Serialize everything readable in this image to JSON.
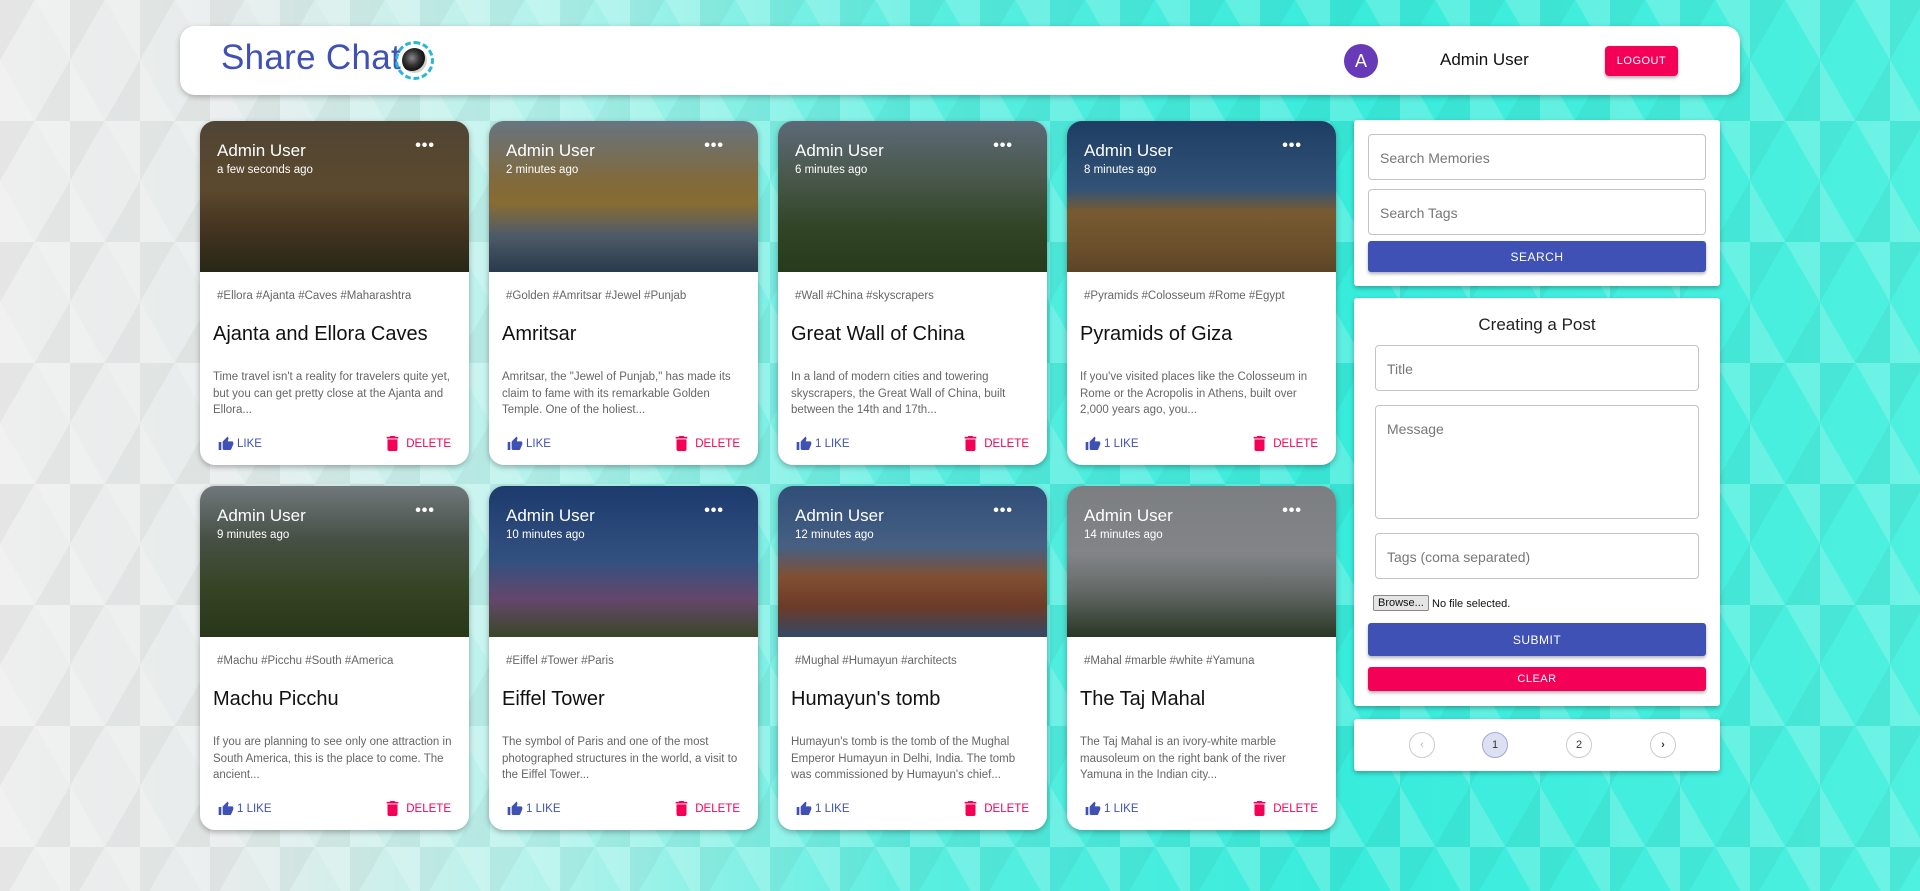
{
  "header": {
    "brand": "Share Chat",
    "avatar_letter": "A",
    "username": "Admin User",
    "logout_label": "LOGOUT"
  },
  "colors": {
    "primary": "#3f51b5",
    "secondary": "#f50057",
    "avatar": "#673ab7"
  },
  "cards": [
    {
      "author": "Admin User",
      "time": "a few seconds ago",
      "tags": "#Ellora #Ajanta #Caves #Maharashtra",
      "title": "Ajanta and Ellora Caves",
      "message": "Time travel isn't a reality for travelers quite yet, but you can get pretty close at the Ajanta and Ellora...",
      "like": "LIKE",
      "delete": "DELETE"
    },
    {
      "author": "Admin User",
      "time": "2 minutes ago",
      "tags": "#Golden #Amritsar #Jewel #Punjab",
      "title": "Amritsar",
      "message": "Amritsar, the \"Jewel of Punjab,\" has made its claim to fame with its remarkable Golden Temple. One of the holiest...",
      "like": "LIKE",
      "delete": "DELETE"
    },
    {
      "author": "Admin User",
      "time": "6 minutes ago",
      "tags": "#Wall #China #skyscrapers",
      "title": "Great Wall of China",
      "message": "In a land of modern cities and towering skyscrapers, the Great Wall of China, built between the 14th and 17th...",
      "like": "1 LIKE",
      "delete": "DELETE"
    },
    {
      "author": "Admin User",
      "time": "8 minutes ago",
      "tags": "#Pyramids #Colosseum #Rome #Egypt",
      "title": "Pyramids of Giza",
      "message": "If you've visited places like the Colosseum in Rome or the Acropolis in Athens, built over 2,000 years ago, you...",
      "like": "1 LIKE",
      "delete": "DELETE"
    },
    {
      "author": "Admin User",
      "time": "9 minutes ago",
      "tags": "#Machu #Picchu #South #America",
      "title": "Machu Picchu",
      "message": "If you are planning to see only one attraction in South America, this is the place to come. The ancient...",
      "like": "1 LIKE",
      "delete": "DELETE"
    },
    {
      "author": "Admin User",
      "time": "10 minutes ago",
      "tags": "#Eiffel #Tower #Paris",
      "title": "Eiffel Tower",
      "message": "The symbol of Paris and one of the most photographed structures in the world, a visit to the Eiffel Tower...",
      "like": "1 LIKE",
      "delete": "DELETE"
    },
    {
      "author": "Admin User",
      "time": "12 minutes ago",
      "tags": "#Mughal #Humayun #architects",
      "title": "Humayun's tomb",
      "message": "Humayun's tomb is the tomb of the Mughal Emperor Humayun in Delhi, India. The tomb was commissioned by Humayun's chief...",
      "like": "1 LIKE",
      "delete": "DELETE"
    },
    {
      "author": "Admin User",
      "time": "14 minutes ago",
      "tags": "#Mahal #marble #white #Yamuna",
      "title": "The Taj Mahal",
      "message": "The Taj Mahal is an ivory-white marble mausoleum on the right bank of the river Yamuna in the Indian city...",
      "like": "1 LIKE",
      "delete": "DELETE"
    }
  ],
  "search": {
    "memories_placeholder": "Search Memories",
    "tags_placeholder": "Search Tags",
    "button": "SEARCH"
  },
  "form": {
    "heading": "Creating a Post",
    "title_placeholder": "Title",
    "message_placeholder": "Message",
    "tags_placeholder": "Tags (coma separated)",
    "browse_label": "Browse...",
    "file_status": "No file selected.",
    "submit": "SUBMIT",
    "clear": "CLEAR"
  },
  "pagination": {
    "prev": "‹",
    "pages": [
      "1",
      "2"
    ],
    "current": "1",
    "next": "›"
  }
}
